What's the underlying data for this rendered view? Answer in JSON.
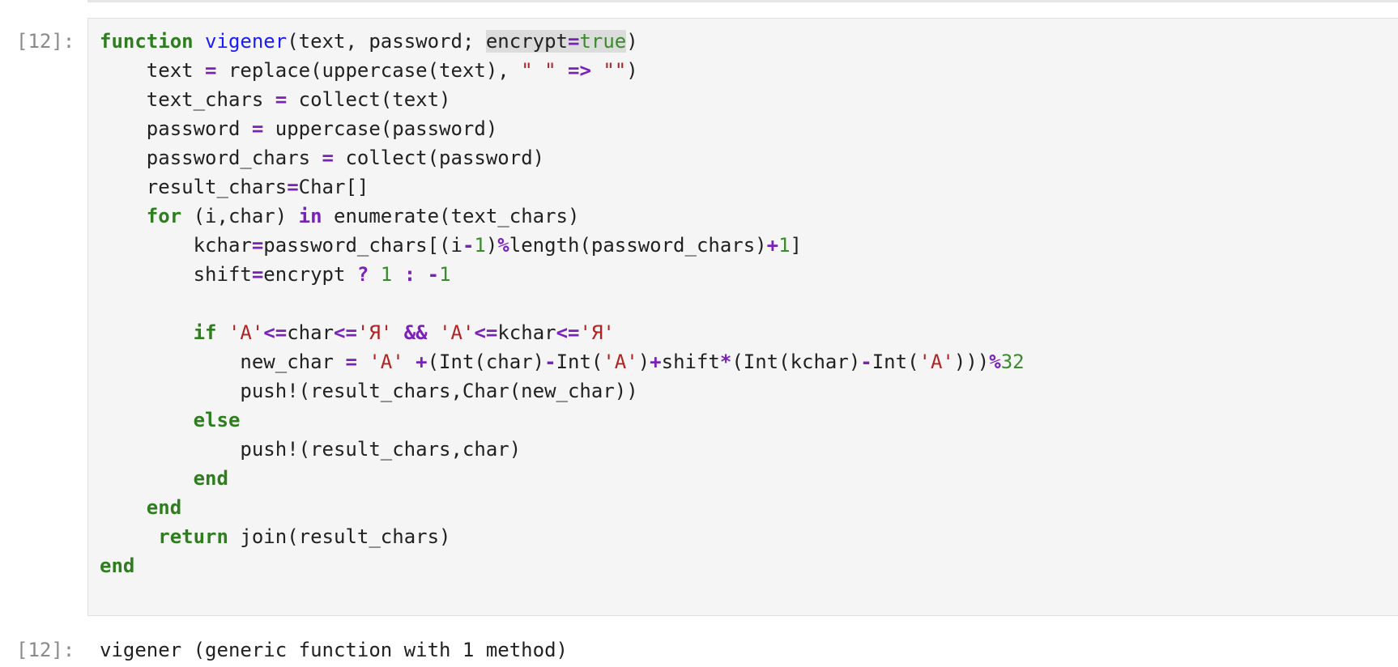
{
  "cell": {
    "input_prompt": "[12]:",
    "output_prompt": "[12]:",
    "output_text": "vigener (generic function with 1 method)"
  },
  "code_lines": [
    [
      [
        "kw",
        "function"
      ],
      [
        "t",
        " "
      ],
      [
        "fn",
        "vigener"
      ],
      [
        "t",
        "(text, password; "
      ],
      [
        "hl",
        "encrypt"
      ],
      [
        "hlop",
        "="
      ],
      [
        "hlbool",
        "true"
      ],
      [
        "t",
        ")"
      ]
    ],
    [
      [
        "t",
        "    text "
      ],
      [
        "op",
        "="
      ],
      [
        "t",
        " replace(uppercase(text), "
      ],
      [
        "str",
        "\" \""
      ],
      [
        "t",
        " "
      ],
      [
        "op",
        "=>"
      ],
      [
        "t",
        " "
      ],
      [
        "str",
        "\"\""
      ],
      [
        "t",
        ")"
      ]
    ],
    [
      [
        "t",
        "    text_chars "
      ],
      [
        "op",
        "="
      ],
      [
        "t",
        " collect(text)"
      ]
    ],
    [
      [
        "t",
        "    password "
      ],
      [
        "op",
        "="
      ],
      [
        "t",
        " uppercase(password)"
      ]
    ],
    [
      [
        "t",
        "    password_chars "
      ],
      [
        "op",
        "="
      ],
      [
        "t",
        " collect(password)"
      ]
    ],
    [
      [
        "t",
        "    result_chars"
      ],
      [
        "op",
        "="
      ],
      [
        "t",
        "Char[]"
      ]
    ],
    [
      [
        "t",
        "    "
      ],
      [
        "kw",
        "for"
      ],
      [
        "t",
        " (i,char) "
      ],
      [
        "op",
        "in"
      ],
      [
        "t",
        " enumerate(text_chars)"
      ]
    ],
    [
      [
        "t",
        "        kchar"
      ],
      [
        "op",
        "="
      ],
      [
        "t",
        "password_chars[(i"
      ],
      [
        "op",
        "-"
      ],
      [
        "num",
        "1"
      ],
      [
        "t",
        ")"
      ],
      [
        "op",
        "%"
      ],
      [
        "t",
        "length(password_chars)"
      ],
      [
        "op",
        "+"
      ],
      [
        "num",
        "1"
      ],
      [
        "t",
        "]"
      ]
    ],
    [
      [
        "t",
        "        shift"
      ],
      [
        "op",
        "="
      ],
      [
        "t",
        "encrypt "
      ],
      [
        "op",
        "?"
      ],
      [
        "t",
        " "
      ],
      [
        "num",
        "1"
      ],
      [
        "t",
        " "
      ],
      [
        "op",
        ":"
      ],
      [
        "t",
        " "
      ],
      [
        "op",
        "-"
      ],
      [
        "num",
        "1"
      ]
    ],
    [
      [
        "t",
        ""
      ]
    ],
    [
      [
        "t",
        "        "
      ],
      [
        "kw",
        "if"
      ],
      [
        "t",
        " "
      ],
      [
        "str",
        "'А'"
      ],
      [
        "op",
        "<="
      ],
      [
        "t",
        "char"
      ],
      [
        "op",
        "<="
      ],
      [
        "str",
        "'Я'"
      ],
      [
        "t",
        " "
      ],
      [
        "op",
        "&&"
      ],
      [
        "t",
        " "
      ],
      [
        "str",
        "'А'"
      ],
      [
        "op",
        "<="
      ],
      [
        "t",
        "kchar"
      ],
      [
        "op",
        "<="
      ],
      [
        "str",
        "'Я'"
      ]
    ],
    [
      [
        "t",
        "            new_char "
      ],
      [
        "op",
        "="
      ],
      [
        "t",
        " "
      ],
      [
        "str",
        "'А'"
      ],
      [
        "t",
        " "
      ],
      [
        "op",
        "+"
      ],
      [
        "t",
        "(Int(char)"
      ],
      [
        "op",
        "-"
      ],
      [
        "t",
        "Int("
      ],
      [
        "str",
        "'А'"
      ],
      [
        "t",
        ")"
      ],
      [
        "op",
        "+"
      ],
      [
        "t",
        "shift"
      ],
      [
        "op",
        "*"
      ],
      [
        "t",
        "(Int(kchar)"
      ],
      [
        "op",
        "-"
      ],
      [
        "t",
        "Int("
      ],
      [
        "str",
        "'А'"
      ],
      [
        "t",
        ")))"
      ],
      [
        "op",
        "%"
      ],
      [
        "num",
        "32"
      ]
    ],
    [
      [
        "t",
        "            push!(result_chars,Char(new_char))"
      ]
    ],
    [
      [
        "t",
        "        "
      ],
      [
        "kw",
        "else"
      ]
    ],
    [
      [
        "t",
        "            push!(result_chars,char)"
      ]
    ],
    [
      [
        "t",
        "        "
      ],
      [
        "kw",
        "end"
      ]
    ],
    [
      [
        "t",
        "    "
      ],
      [
        "kw",
        "end"
      ]
    ],
    [
      [
        "t",
        "     "
      ],
      [
        "kw",
        "return"
      ],
      [
        "t",
        " join(result_chars)"
      ]
    ],
    [
      [
        "kw",
        "end"
      ]
    ]
  ]
}
